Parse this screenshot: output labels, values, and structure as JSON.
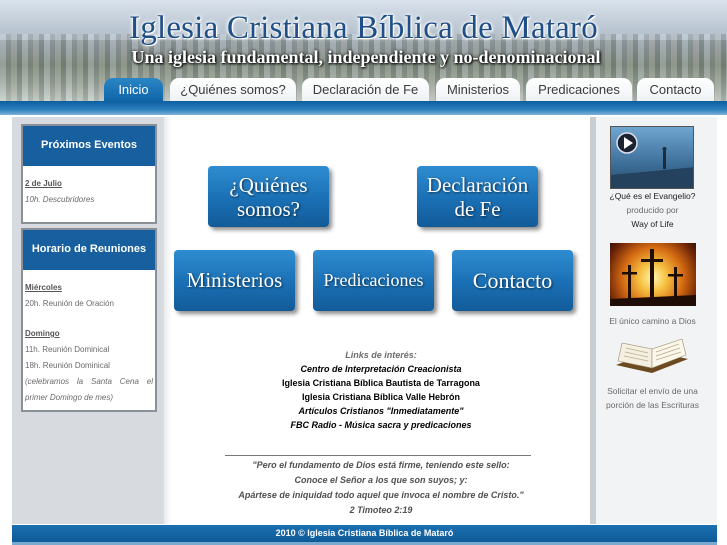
{
  "header": {
    "title": "Iglesia Cristiana Bíblica de Mataró",
    "subtitle": "Una iglesia fundamental, independiente y no-denominacional"
  },
  "nav": {
    "tabs": [
      {
        "label": "Inicio",
        "active": true
      },
      {
        "label": "¿Quiénes somos?",
        "active": false
      },
      {
        "label": "Declaración de Fe",
        "active": false
      },
      {
        "label": "Ministerios",
        "active": false
      },
      {
        "label": "Predicaciones",
        "active": false
      },
      {
        "label": "Contacto",
        "active": false
      }
    ]
  },
  "events": {
    "title": "Próximos Eventos",
    "date": "2 de Julio",
    "item": "10h. Descubridores"
  },
  "schedule": {
    "title": "Horario de Reuniones",
    "day1": "Miércoles",
    "day1_item": "20h. Reunión de Oración",
    "day2": "Domingo",
    "day2_item1": "11h. Reunión Dominical",
    "day2_item2": "18h. Reunión Dominical",
    "note": "(celebramos la Santa Cena el primer Domingo de mes)"
  },
  "main_buttons": {
    "quienes_line1": "¿Quiénes",
    "quienes_line2": "somos?",
    "declaracion_line1": "Declaración",
    "declaracion_line2": "de Fe",
    "ministerios": "Ministerios",
    "predicaciones": "Predicaciones",
    "contacto": "Contacto"
  },
  "links": {
    "title": "Links de interés:",
    "items": [
      "Centro de Interpretación Creacionista",
      "Iglesia Cristiana Bíblica Bautista de Tarragona",
      "Iglesia Cristiana Bíblica Valle Hebrón",
      "Artículos Cristianos \"Inmediatamente\"",
      "FBC Radio - Música sacra y predicaciones"
    ]
  },
  "quote": {
    "line1": "\"Pero el fundamento de Dios está firme, teniendo este sello:",
    "line2": "Conoce el Señor a los que son suyos; y:",
    "line3": "Apártese de iniquidad todo aquel que invoca el nombre de Cristo.\"",
    "ref": "2 Timoteo 2:19"
  },
  "sidebar": {
    "video_caption": "¿Qué es el Evangelio?",
    "video_by": "producido por",
    "video_producer": "Way of Life",
    "cross_caption": "El único camino a Dios",
    "bible_caption": "Solicitar el envío de una porción de las Escrituras"
  },
  "footer": {
    "text": "2010 © Iglesia Cristiana Bíblica de Mataró"
  },
  "colors": {
    "accent": "#175f9e",
    "tab_active": "#1a72b6",
    "button": "#1a6fb4"
  }
}
